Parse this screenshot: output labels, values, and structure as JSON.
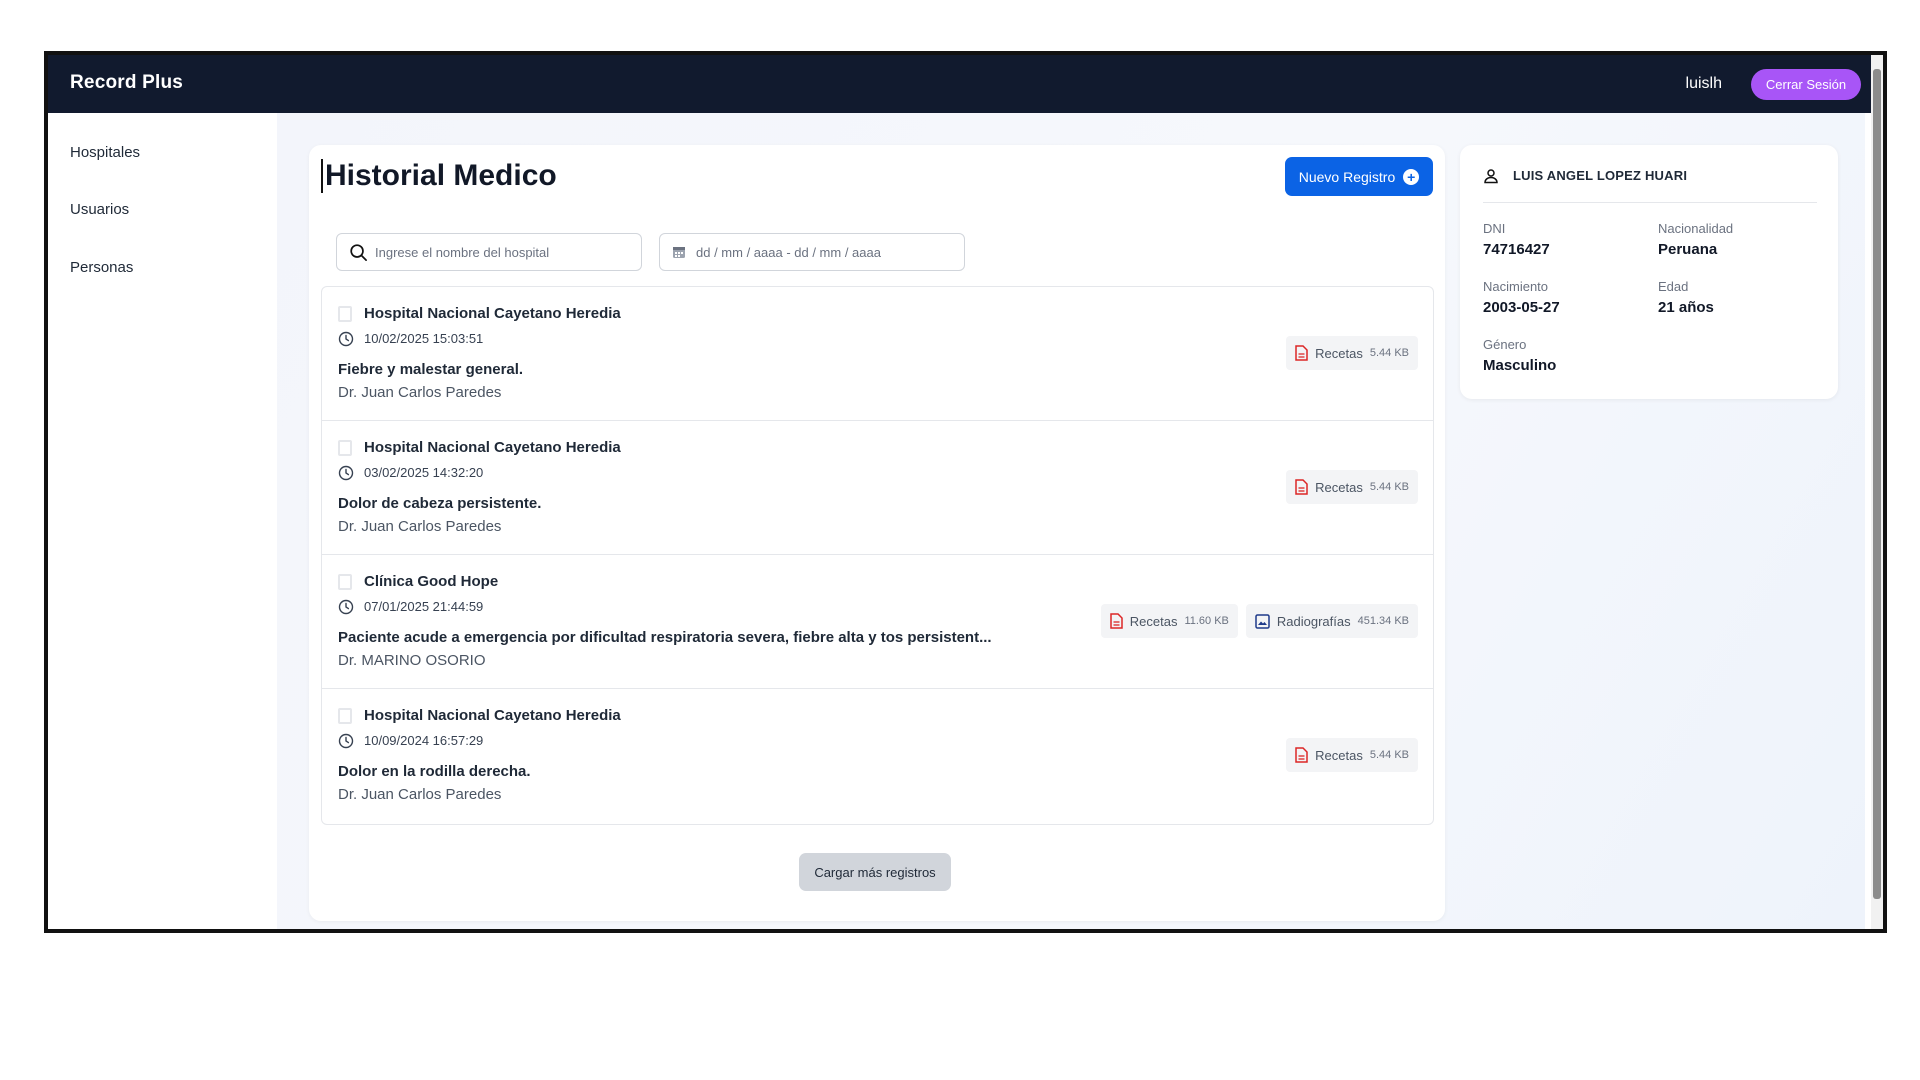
{
  "app": {
    "title": "Record Plus"
  },
  "header": {
    "username": "luislh",
    "logout_label": "Cerrar Sesión"
  },
  "sidebar": {
    "items": [
      {
        "label": "Hospitales"
      },
      {
        "label": "Usuarios"
      },
      {
        "label": "Personas"
      }
    ]
  },
  "main": {
    "title": "Historial Medico",
    "new_record_label": "Nuevo Registro",
    "search_placeholder": "Ingrese el nombre del hospital",
    "date_range_placeholder": "dd / mm / aaaa  -  dd / mm / aaaa",
    "load_more_label": "Cargar más registros",
    "records": [
      {
        "hospital": "Hospital Nacional Cayetano Heredia",
        "datetime": "10/02/2025 15:03:51",
        "description": "Fiebre y malestar general.",
        "doctor": "Dr. Juan Carlos Paredes",
        "attachments": [
          {
            "type": "pdf",
            "label": "Recetas",
            "size": "5.44 KB"
          }
        ]
      },
      {
        "hospital": "Hospital Nacional Cayetano Heredia",
        "datetime": "03/02/2025 14:32:20",
        "description": "Dolor de cabeza persistente.",
        "doctor": "Dr. Juan Carlos Paredes",
        "attachments": [
          {
            "type": "pdf",
            "label": "Recetas",
            "size": "5.44 KB"
          }
        ]
      },
      {
        "hospital": "Clínica Good Hope",
        "datetime": "07/01/2025 21:44:59",
        "description": "Paciente acude a emergencia por dificultad respiratoria severa, fiebre alta y tos persistent...",
        "doctor": "Dr. MARINO OSORIO",
        "attachments": [
          {
            "type": "pdf",
            "label": "Recetas",
            "size": "11.60 KB"
          },
          {
            "type": "image",
            "label": "Radiografías",
            "size": "451.34 KB"
          }
        ]
      },
      {
        "hospital": "Hospital Nacional Cayetano Heredia",
        "datetime": "10/09/2024 16:57:29",
        "description": "Dolor en la rodilla derecha.",
        "doctor": "Dr. Juan Carlos Paredes",
        "attachments": [
          {
            "type": "pdf",
            "label": "Recetas",
            "size": "5.44 KB"
          }
        ]
      }
    ]
  },
  "profile": {
    "name": "LUIS ANGEL LOPEZ HUARI",
    "dni_label": "DNI",
    "dni": "74716427",
    "nationality_label": "Nacionalidad",
    "nationality": "Peruana",
    "birth_label": "Nacimiento",
    "birth": "2003-05-27",
    "age_label": "Edad",
    "age": "21 años",
    "gender_label": "Género",
    "gender": "Masculino"
  },
  "colors": {
    "topbar": "#111a2e",
    "accent": "#0b63e5",
    "logout": "#a855f7",
    "pdf_icon": "#dc2626",
    "image_icon": "#1e3a8a"
  },
  "icons": {
    "search": "search-icon",
    "calendar": "calendar-icon",
    "clock": "clock-icon",
    "hospital": "hospital-icon",
    "pdf": "pdf-file-icon",
    "image": "image-file-icon",
    "user": "user-icon",
    "plus": "plus-circle-icon"
  }
}
